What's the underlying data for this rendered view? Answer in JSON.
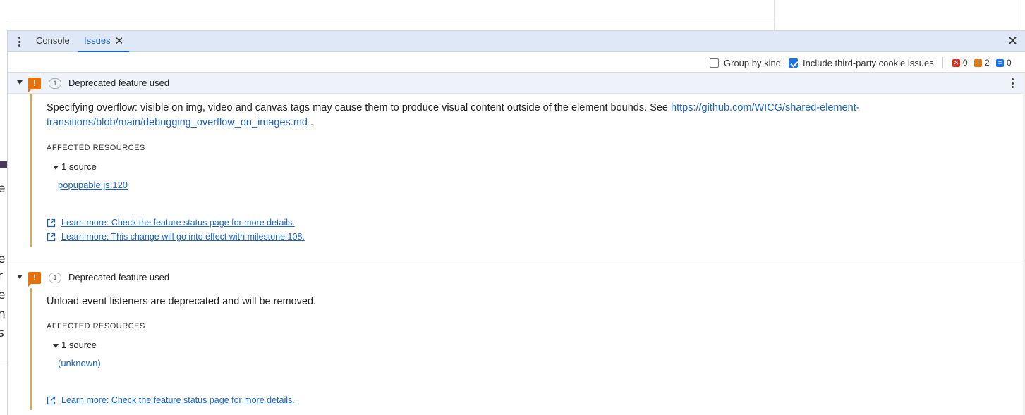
{
  "background": {
    "glyphs": [
      "e",
      "e",
      "r",
      "e",
      "n",
      "s"
    ]
  },
  "devtools": {
    "tabs": [
      {
        "label": "Console"
      },
      {
        "label": "Issues",
        "active": true
      }
    ],
    "toolbar": {
      "group_by_kind": {
        "label": "Group by kind",
        "checked": false
      },
      "third_party": {
        "label": "Include third-party cookie issues",
        "checked": true
      },
      "counts": {
        "errors": "0",
        "warnings": "2",
        "info": "0"
      }
    }
  },
  "issues": [
    {
      "count": "1",
      "title": "Deprecated feature used",
      "description": "Specifying overflow: visible on img, video and canvas tags may cause them to produce visual content outside of the element bounds. See ",
      "description_link": "https://github.com/WICG/shared-element-transitions/blob/main/debugging_overflow_on_images.md",
      "description_tail": " .",
      "affected_title": "AFFECTED RESOURCES",
      "source_toggle": "1 source",
      "source": "popupable.js:120",
      "learn_more": [
        "Learn more: Check the feature status page for more details.",
        "Learn more: This change will go into effect with milestone 108."
      ]
    },
    {
      "count": "1",
      "title": "Deprecated feature used",
      "description": "Unload event listeners are deprecated and will be removed.",
      "affected_title": "AFFECTED RESOURCES",
      "source_toggle": "1 source",
      "source": "(unknown)",
      "learn_more": [
        "Learn more: Check the feature status page for more details."
      ]
    }
  ],
  "colors": {
    "accent": "#1a63c8",
    "warning": "#e8710a",
    "error": "#d93025",
    "tabbar_bg": "#dfe8f6"
  },
  "icons": {
    "kebab": "more-vert-icon",
    "close": "close-icon",
    "warning": "warning-flag-icon",
    "external": "external-link-icon"
  }
}
